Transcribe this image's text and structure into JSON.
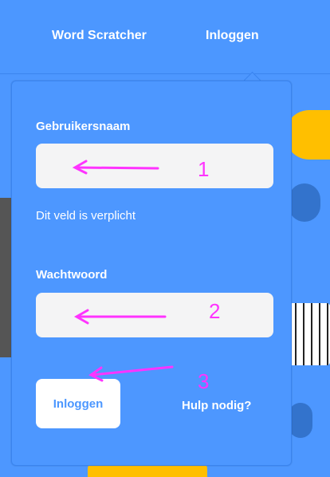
{
  "nav": {
    "word_scratcher": "Word Scratcher",
    "login": "Inloggen"
  },
  "form": {
    "username_label": "Gebruikersnaam",
    "username_value": "",
    "required_hint": "Dit veld is verplicht",
    "password_label": "Wachtwoord",
    "password_value": "",
    "submit_label": "Inloggen",
    "help_link": "Hulp nodig?"
  },
  "annotations": {
    "n1": "1",
    "n2": "2",
    "n3": "3"
  },
  "colors": {
    "accent": "#4c97ff",
    "annotation": "#ff33ff"
  }
}
